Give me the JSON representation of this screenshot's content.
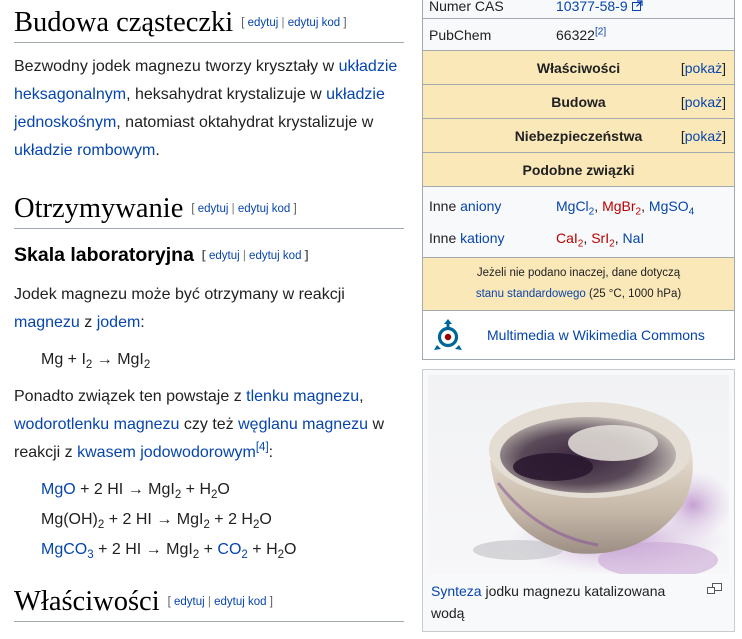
{
  "sections": {
    "budowa": {
      "title": "Budowa cząsteczki"
    },
    "otrzymywanie": {
      "title": "Otrzymywanie"
    },
    "skala": {
      "title": "Skala laboratoryjna"
    },
    "wlasciwosci": {
      "title": "Właściwości"
    }
  },
  "edit": {
    "edit": "edytuj",
    "separator": "|",
    "edit_code": "edytuj kod"
  },
  "budowa_para": {
    "t1": "Bezwodny jodek magnezu tworzy kryształy w ",
    "l1": "układzie heksagonalnym",
    "t2": ", heksahydrat krystalizuje w ",
    "l2": "układzie jednoskośnym",
    "t3": ", natomiast oktahydrat krystalizuje w ",
    "l3": "układzie rombowym",
    "t4": "."
  },
  "otrz_para1": {
    "t1": "Jodek magnezu może być otrzymany w reakcji ",
    "l1": "magnezu",
    "t2": " z ",
    "l2": "jodem",
    "t3": ":"
  },
  "eq1": {
    "a": "Mg + I",
    "a_sub": "2",
    "arrow": " → ",
    "b": "MgI",
    "b_sub": "2"
  },
  "otrz_para2": {
    "t1": "Ponadto związek ten powstaje z ",
    "l1": "tlenku magnezu",
    "t2": ", ",
    "l2": "wodorotlenku magnezu",
    "t3": " czy też ",
    "l3": "węglanu magnezu",
    "t4": " w reakcji z ",
    "l4": "kwasem jodowodorowym",
    "ref": "[4]",
    "t5": ":"
  },
  "eq2": {
    "a": "MgO",
    "b": " + 2 HI → MgI",
    "b_sub": "2",
    "c": " + H",
    "c_sub": "2",
    "d": "O"
  },
  "eq3": {
    "a": "Mg(OH)",
    "a_sub": "2",
    "b": " + 2 HI → MgI",
    "b_sub": "2",
    "c": " + 2 H",
    "c_sub": "2",
    "d": "O"
  },
  "eq4": {
    "a": "MgCO",
    "a_sub": "3",
    "b": " + 2 HI → MgI",
    "b_sub": "2",
    "c": " + ",
    "d": "CO",
    "d_sub": "2",
    "e": " + H",
    "e_sub": "2",
    "f": "O"
  },
  "infobox": {
    "cas_label": "Numer CAS",
    "cas_value": "10377-58-9",
    "pubchem_label": "PubChem",
    "pubchem_value": "66322",
    "pubchem_ref": "[2]",
    "sections": [
      {
        "title": "Właściwości",
        "toggle_open": "[",
        "toggle": "pokaż",
        "toggle_close": "]"
      },
      {
        "title": "Budowa",
        "toggle_open": "[",
        "toggle": "pokaż",
        "toggle_close": "]"
      },
      {
        "title": "Niebezpieczeństwa",
        "toggle_open": "[",
        "toggle": "pokaż",
        "toggle_close": "]"
      }
    ],
    "related_title": "Podobne związki",
    "anions": {
      "label_pre": "Inne ",
      "label_link": "aniony",
      "v1": "MgCl",
      "v1_sub": "2",
      "sep1": ", ",
      "v2": "MgBr",
      "v2_sub": "2",
      "sep2": ", ",
      "v3": "MgSO",
      "v3_sub": "4"
    },
    "cations": {
      "label_pre": "Inne ",
      "label_link": "kationy",
      "v1": "CaI",
      "v1_sub": "2",
      "sep1": ", ",
      "v2": "SrI",
      "v2_sub": "2",
      "sep2": ", ",
      "v3": "NaI"
    },
    "note": {
      "t1": "Jeżeli nie podano inaczej, dane dotyczą",
      "link": "stanu standardowego",
      "t2": " (25 °C, 1000 hPa)"
    },
    "commons_link": "Multimedia w Wikimedia Commons"
  },
  "thumb": {
    "caption_link": "Synteza",
    "caption_text": " jodku magnezu katalizowana wodą"
  },
  "colors": {
    "link": "#0645ad",
    "redlink": "#ba0000",
    "infobox_header": "#fbe8b8",
    "infobox_bg": "#f8f9fa"
  },
  "icons": {
    "cas_external": "external-link-icon",
    "commons": "wikimedia-commons-logo",
    "thumb_magnify": "magnify-icon"
  }
}
